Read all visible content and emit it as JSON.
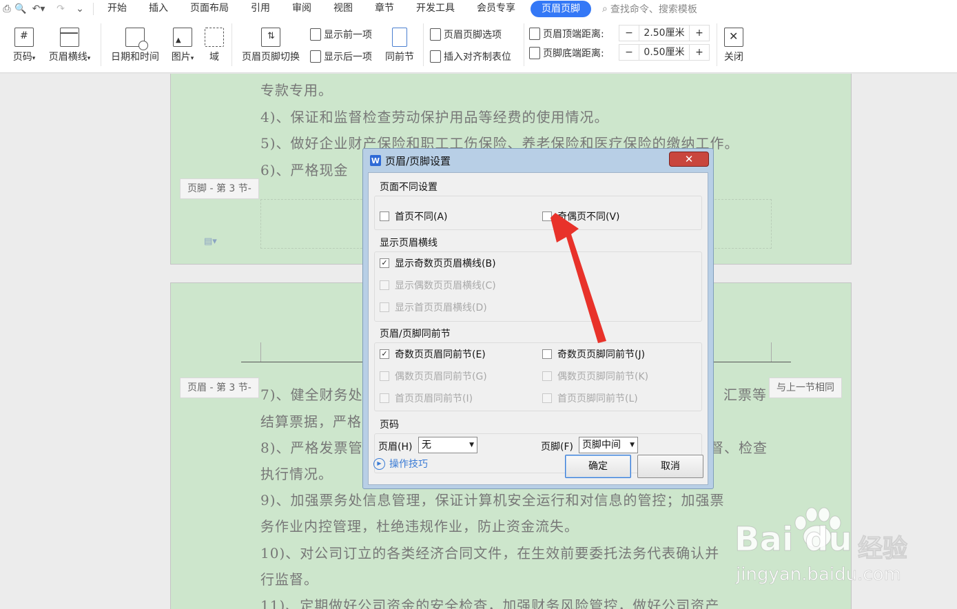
{
  "menubar": {
    "tabs": [
      "开始",
      "插入",
      "页面布局",
      "引用",
      "审阅",
      "视图",
      "章节",
      "开发工具",
      "会员专享"
    ],
    "active_tab": "页眉页脚",
    "search_placeholder": "查找命令、搜索模板"
  },
  "toolbar": {
    "page_number": "页码",
    "header_line": "页眉横线",
    "datetime": "日期和时间",
    "picture": "图片",
    "field": "域",
    "switch": "页眉页脚切换",
    "show_prev": "显示前一项",
    "show_next": "显示后一项",
    "same_as_prev": "同前节",
    "hf_options": "页眉页脚选项",
    "insert_tab": "插入对齐制表位",
    "header_top_label": "页眉顶端距离:",
    "header_top_value": "2.50厘米",
    "footer_bottom_label": "页脚底端距离:",
    "footer_bottom_value": "0.50厘米",
    "close": "关闭"
  },
  "document": {
    "page1_lines": [
      "专款专用。",
      "4)、保证和监督检查劳动保护用品等经费的使用情况。",
      "5)、做好企业财产保险和职工工伤保险、养老保险和医疗保险的缴纳工作。",
      "6)、严格现金"
    ],
    "footer_tag": "页脚 - 第 3 节-",
    "header_tag": "页眉 - 第 3 节-",
    "same_as_prev_tag": "与上一节相同",
    "page2_lines": [
      "7)、健全财务处",
      "汇票等",
      "结算票据，严格",
      "8)、严格发票管",
      "督、检查",
      "执行情况。",
      "9)、加强票务处信息管理，保证计算机安全运行和对信息的管控；加强票",
      "务作业内控管理，杜绝违规作业，防止资金流失。",
      "10)、对公司订立的各类经济合同文件，在生效前要委托法务代表确认并",
      "行监督。",
      "11)、定期做好公司资金的安全检查，加强财务风险管控，做好公司资产"
    ]
  },
  "dialog": {
    "title": "页眉/页脚设置",
    "close_glyph": "✕",
    "group_diff": "页面不同设置",
    "first_page_diff": "首页不同(A)",
    "odd_even_diff": "奇偶页不同(V)",
    "group_line": "显示页眉横线",
    "show_odd_line": "显示奇数页页眉横线(B)",
    "show_even_line": "显示偶数页页眉横线(C)",
    "show_first_line": "显示首页页眉横线(D)",
    "group_same": "页眉/页脚同前节",
    "odd_header_same": "奇数页页眉同前节(E)",
    "odd_footer_same": "奇数页页脚同前节(J)",
    "even_header_same": "偶数页页眉同前节(G)",
    "even_footer_same": "偶数页页脚同前节(K)",
    "first_header_same": "首页页眉同前节(I)",
    "first_footer_same": "首页页脚同前节(L)",
    "group_pagenum": "页码",
    "header_label": "页眉(H)",
    "header_value": "无",
    "footer_label": "页脚(F)",
    "footer_value": "页脚中间",
    "tips": "操作技巧",
    "ok": "确定",
    "cancel": "取消",
    "checked": {
      "first_page_diff": false,
      "odd_even_diff": false,
      "show_odd_line": true,
      "odd_header_same": true,
      "odd_footer_same": false
    }
  },
  "watermark": {
    "logo": "Bai du",
    "cn": "经验",
    "url": "jingyan.baidu.com"
  },
  "colors": {
    "accent": "#3478f6",
    "page_green": "#cde6cc",
    "arrow_red": "#e8322a",
    "dialog_frame": "#b8cfe6"
  }
}
